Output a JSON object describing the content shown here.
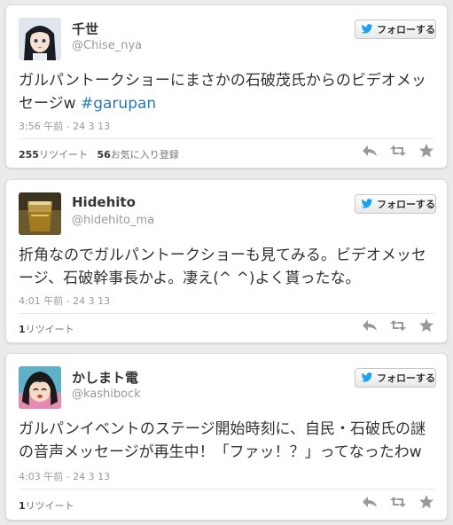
{
  "follow_label": "フォローする",
  "tweets": [
    {
      "name": "千世",
      "handle": "@Chise_nya",
      "text": "ガルパントークショーにまさかの石破茂氏からのビデオメッセージw",
      "hashtag": "#garupan",
      "time": "3:56 午前 - 24 3 13",
      "retweets": "255",
      "retweets_label": "リツイート",
      "favorites": "56",
      "favorites_label": "お気に入り登録"
    },
    {
      "name": "Hidehito",
      "handle": "@hidehito_ma",
      "text": "折角なのでガルパントークショーも見てみる。ビデオメッセージ、石破幹事長かよ。凄え(^ ^)よく貰ったな。",
      "hashtag": "",
      "time": "4:01 午前 - 24 3 13",
      "retweets": "1",
      "retweets_label": "リツイート"
    },
    {
      "name": "かしまト電",
      "handle": "@kashibock",
      "text": "ガルパンイベントのステージ開始時刻に、自民・石破氏の謎の音声メッセージが再生中！「ファッ！？」ってなったわw",
      "hashtag": "",
      "time": "4:03 午前 - 24 3 13",
      "retweets": "1",
      "retweets_label": "リツイート"
    }
  ],
  "colors": {
    "link": "#2b7bb9",
    "bird": "#1da1f2",
    "icon": "#999999"
  }
}
